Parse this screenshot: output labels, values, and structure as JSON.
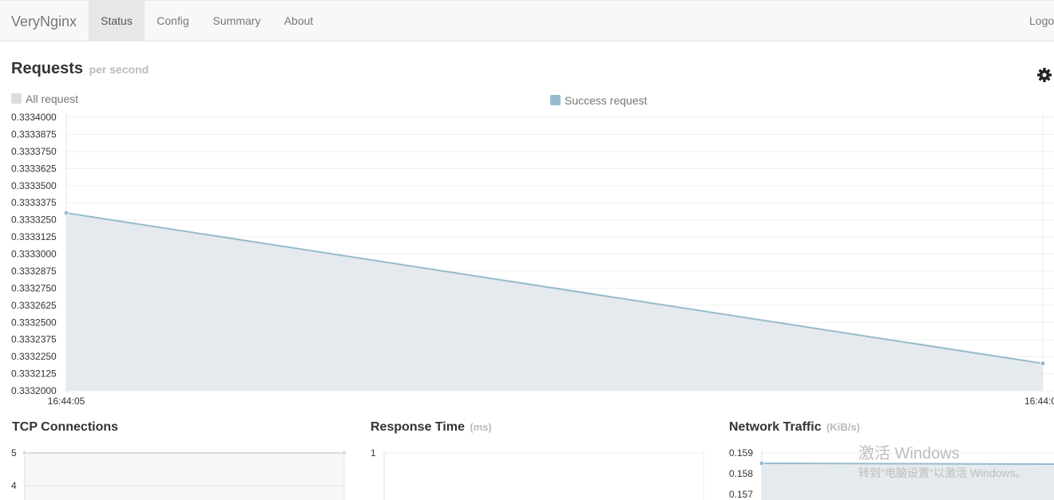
{
  "nav": {
    "brand": "VeryNginx",
    "items": [
      "Status",
      "Config",
      "Summary",
      "About"
    ],
    "active": "Status",
    "logout": "Logout"
  },
  "requests": {
    "title": "Requests",
    "unit": "per second",
    "legend_all": "All request",
    "legend_success": "Success request"
  },
  "tcp": {
    "title": "TCP Connections"
  },
  "response": {
    "title": "Response Time",
    "unit": "(ms)"
  },
  "network": {
    "title": "Network Traffic",
    "unit": "(KiB/s)"
  },
  "watermark": {
    "title": "激活 Windows",
    "subtitle": "转到\"电脑设置\"以激活 Windows。"
  },
  "colors": {
    "success_line": "#97bbcd",
    "success_fill": "#e2e8ec",
    "all_request": "#dcdcdc",
    "navbar_bg": "#f8f8f8"
  },
  "icons": {
    "settings": "gear-icon"
  },
  "chart_data": [
    {
      "type": "area",
      "title": "Requests per second",
      "x": [
        "16:44:05",
        "16:44:0"
      ],
      "series": [
        {
          "name": "Success request",
          "values": [
            0.33333,
            0.33322
          ]
        }
      ],
      "yticks": [
        "0.3334000",
        "0.3333875",
        "0.3333750",
        "0.3333625",
        "0.3333500",
        "0.3333375",
        "0.3333250",
        "0.3333125",
        "0.3333000",
        "0.3332875",
        "0.3332750",
        "0.3332625",
        "0.3332500",
        "0.3332375",
        "0.3332250",
        "0.3332125",
        "0.3332000"
      ],
      "ylim": [
        0.3332,
        0.3334
      ],
      "grid": true,
      "legend": "top"
    },
    {
      "type": "line",
      "title": "TCP Connections",
      "series": [
        {
          "values": [
            5,
            5
          ]
        }
      ],
      "yticks": [
        "5",
        "4"
      ],
      "ylim": [
        4,
        5
      ]
    },
    {
      "type": "line",
      "title": "Response Time (ms)",
      "series": [],
      "yticks": [
        "1"
      ]
    },
    {
      "type": "area",
      "title": "Network Traffic (KiB/s)",
      "series": [
        {
          "values": [
            0.1585,
            0.1585
          ]
        }
      ],
      "yticks": [
        "0.159",
        "0.158",
        "0.157"
      ],
      "ylim": [
        0.157,
        0.159
      ]
    }
  ]
}
